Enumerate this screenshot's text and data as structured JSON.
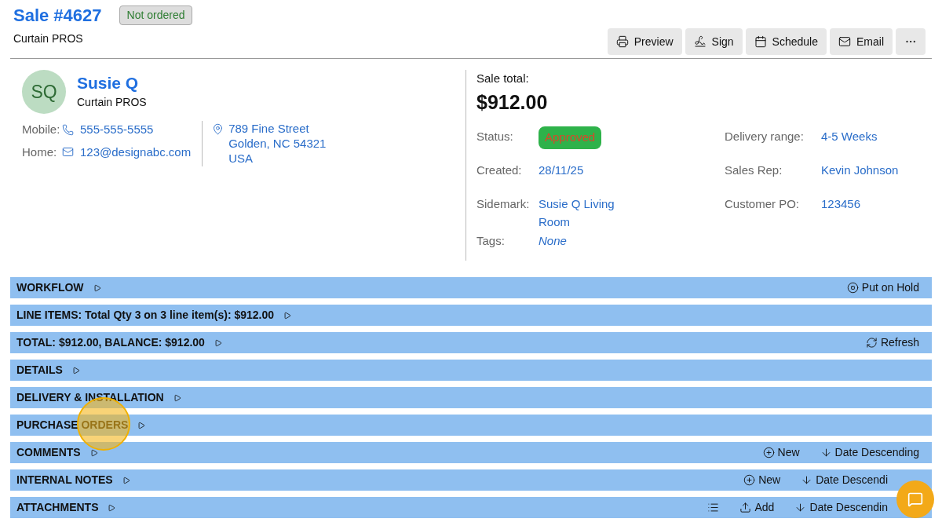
{
  "header": {
    "title": "Sale #4627",
    "order_badge": "Not ordered",
    "company": "Curtain PROS",
    "actions": [
      {
        "kind": "print",
        "label": "Preview"
      },
      {
        "kind": "sign",
        "label": "Sign"
      },
      {
        "kind": "calendar",
        "label": "Schedule"
      },
      {
        "kind": "mail",
        "label": "Email"
      },
      {
        "kind": "more"
      }
    ]
  },
  "customer": {
    "initials": "SQ",
    "name": "Susie Q",
    "company": "Curtain PROS",
    "contacts": [
      {
        "label": "Mobile:",
        "kind": "phone",
        "value": "555-555-5555"
      },
      {
        "label": "Home:",
        "kind": "mail",
        "value": "123@designabc.com"
      }
    ],
    "address": [
      "789 Fine Street",
      "Golden, NC 54321",
      "USA"
    ]
  },
  "summary": {
    "label": "Sale total:",
    "total": "$912.00",
    "fields_left": [
      {
        "label": "Status:",
        "kind": "badge",
        "value": "Approved"
      },
      {
        "label": "Created:",
        "kind": "link",
        "value": "28/11/25"
      },
      {
        "label": "Sidemark:",
        "kind": "link",
        "value": "Susie Q Living Room"
      },
      {
        "label": "Tags:",
        "kind": "empty",
        "value": "None"
      }
    ],
    "fields_right": [
      {
        "label": "Delivery range:",
        "kind": "link",
        "value": "4-5 Weeks"
      },
      {
        "label": "Sales Rep:",
        "kind": "link",
        "value": "Kevin Johnson"
      },
      {
        "label": "Customer PO:",
        "kind": "link",
        "value": "123456"
      }
    ]
  },
  "sections": [
    {
      "title": "WORKFLOW",
      "expanded": false,
      "actions": [
        {
          "kind": "hold",
          "label": "Put on Hold"
        }
      ]
    },
    {
      "title": "LINE ITEMS: Total Qty 3 on 3 line item(s): $912.00",
      "expanded": false
    },
    {
      "title": "TOTAL: $912.00, BALANCE: $912.00",
      "expanded": false,
      "actions": [
        {
          "kind": "refresh",
          "label": "Refresh"
        }
      ]
    },
    {
      "title": "DETAILS",
      "expanded": false
    },
    {
      "title": "DELIVERY & INSTALLATION",
      "expanded": false
    },
    {
      "title": "PURCHASE ORDERS",
      "expanded": false
    },
    {
      "title": "COMMENTS",
      "expanded": false,
      "actions": [
        {
          "kind": "new",
          "label": "New"
        },
        {
          "kind": "sort",
          "label": "Date Descending"
        }
      ]
    },
    {
      "title": "INTERNAL NOTES",
      "expanded": false,
      "actions": [
        {
          "kind": "new",
          "label": "New"
        },
        {
          "kind": "sort",
          "label": "Date Descendi"
        }
      ]
    },
    {
      "title": "ATTACHMENTS",
      "expanded": false,
      "actions": [
        {
          "kind": "list"
        },
        {
          "kind": "add",
          "label": "Add"
        },
        {
          "kind": "sort",
          "label": "Date Descendin"
        }
      ]
    }
  ]
}
